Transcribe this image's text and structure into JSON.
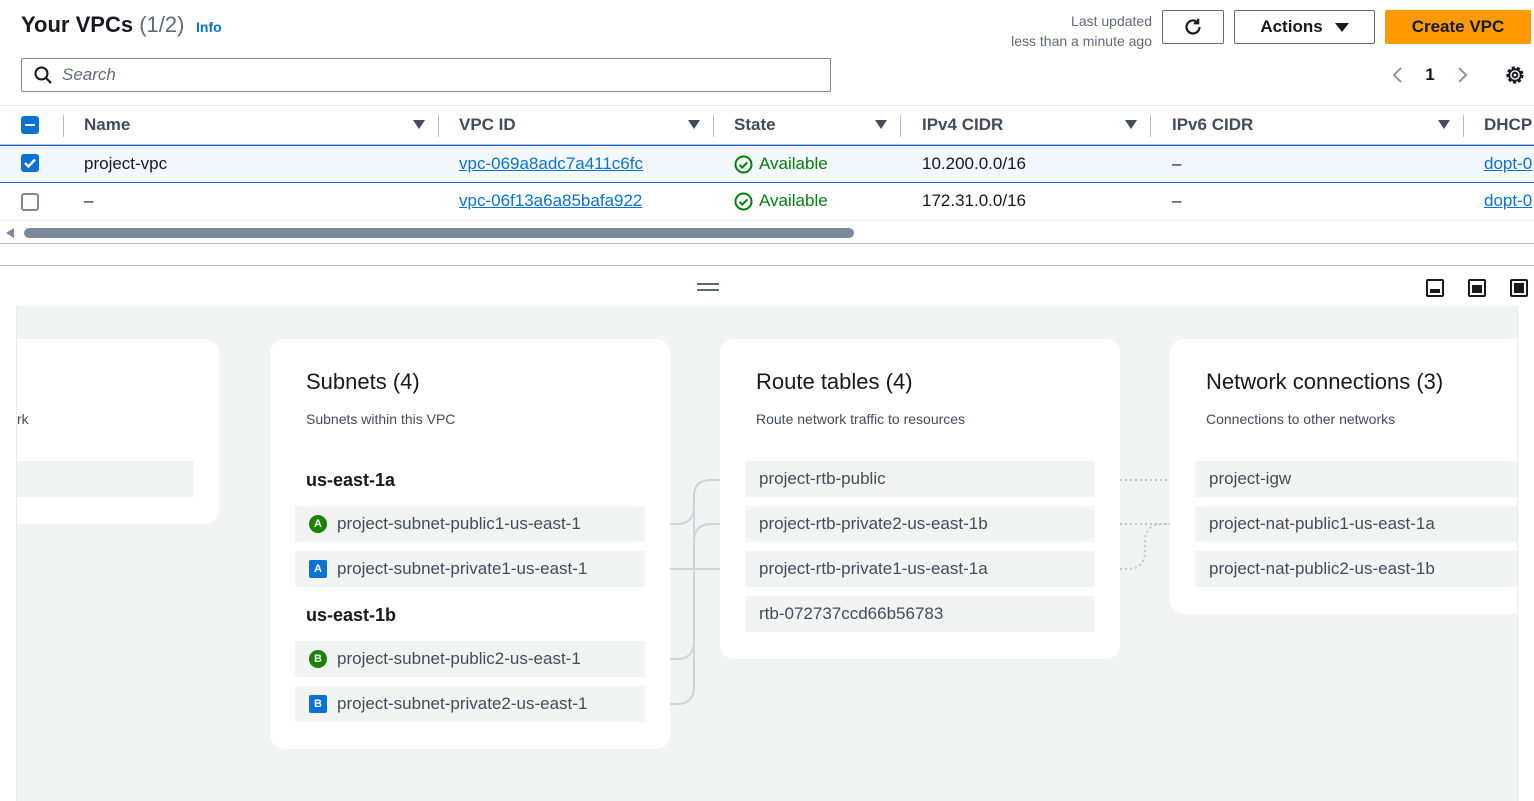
{
  "header": {
    "title": "Your VPCs",
    "count": "(1/2)",
    "info_link": "Info",
    "last_updated_label": "Last updated",
    "last_updated_value": "less than a minute ago",
    "actions_label": "Actions",
    "create_label": "Create VPC",
    "refresh_icon": "refresh-icon"
  },
  "search": {
    "placeholder": "Search",
    "value": ""
  },
  "pagination": {
    "current_page": "1"
  },
  "table": {
    "columns": [
      "Name",
      "VPC ID",
      "State",
      "IPv4 CIDR",
      "IPv6 CIDR",
      "DHCP"
    ],
    "rows": [
      {
        "selected": true,
        "name": "project-vpc",
        "vpc_id": "vpc-069a8adc7a411c6fc",
        "state": "Available",
        "ipv4": "10.200.0.0/16",
        "ipv6": "–",
        "dhcp": "dopt-0"
      },
      {
        "selected": false,
        "name": "–",
        "vpc_id": "vpc-06f13a6a85bafa922",
        "state": "Available",
        "ipv4": "172.31.0.0/16",
        "ipv6": "–",
        "dhcp": "dopt-0"
      }
    ]
  },
  "resource_map": {
    "left_partial_text": "rk",
    "subnets": {
      "title": "Subnets (4)",
      "description": "Subnets within this VPC",
      "zones": [
        {
          "name": "us-east-1a",
          "items": [
            {
              "badge": "A",
              "kind": "public",
              "label": "project-subnet-public1-us-east-1"
            },
            {
              "badge": "A",
              "kind": "private",
              "label": "project-subnet-private1-us-east-1"
            }
          ]
        },
        {
          "name": "us-east-1b",
          "items": [
            {
              "badge": "B",
              "kind": "public",
              "label": "project-subnet-public2-us-east-1"
            },
            {
              "badge": "B",
              "kind": "private",
              "label": "project-subnet-private2-us-east-1"
            }
          ]
        }
      ]
    },
    "route_tables": {
      "title": "Route tables (4)",
      "description": "Route network traffic to resources",
      "items": [
        "project-rtb-public",
        "project-rtb-private2-us-east-1b",
        "project-rtb-private1-us-east-1a",
        "rtb-072737ccd66b56783"
      ]
    },
    "network_connections": {
      "title": "Network connections (3)",
      "description": "Connections to other networks",
      "items": [
        "project-igw",
        "project-nat-public1-us-east-1a",
        "project-nat-public2-us-east-1b"
      ]
    }
  },
  "colors": {
    "accent": "#0972d3",
    "primary_button": "#ff9900",
    "status_available": "#037f0c",
    "public_badge": "#1d8102",
    "private_badge": "#0972d3"
  }
}
